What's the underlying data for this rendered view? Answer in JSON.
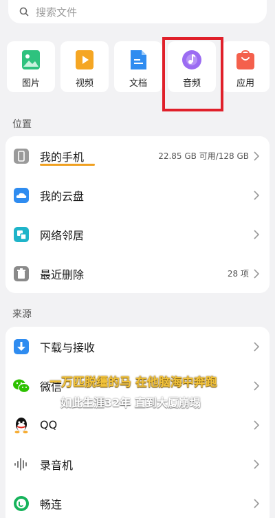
{
  "search": {
    "placeholder": "搜索文件"
  },
  "categories": [
    {
      "label": "图片",
      "icon": "image-icon",
      "color": "#2ec27e"
    },
    {
      "label": "视频",
      "icon": "video-icon",
      "color": "#f5a623"
    },
    {
      "label": "文档",
      "icon": "document-icon",
      "color": "#2f8cf0"
    },
    {
      "label": "音频",
      "icon": "audio-icon",
      "color": "#9b6cf2"
    },
    {
      "label": "应用",
      "icon": "app-store-icon",
      "color": "#f4604c"
    }
  ],
  "location": {
    "title": "位置",
    "items": [
      {
        "label": "我的手机",
        "value": "22.85 GB 可用/128 GB",
        "icon": "phone-icon"
      },
      {
        "label": "我的云盘",
        "value": "",
        "icon": "cloud-drive-icon"
      },
      {
        "label": "网络邻居",
        "value": "",
        "icon": "network-icon"
      },
      {
        "label": "最近删除",
        "value": "28 项",
        "icon": "trash-icon"
      }
    ]
  },
  "source": {
    "title": "来源",
    "items": [
      {
        "label": "下载与接收",
        "icon": "download-icon"
      },
      {
        "label": "微信",
        "icon": "wechat-icon"
      },
      {
        "label": "QQ",
        "icon": "qq-icon"
      },
      {
        "label": "录音机",
        "icon": "recorder-icon"
      },
      {
        "label": "畅连",
        "icon": "changlian-icon"
      }
    ]
  },
  "overlay": {
    "line1": "一万匹脱缰的马 在他脑海中奔跑",
    "line2": "如此生涯32年 直到大厦崩塌"
  }
}
